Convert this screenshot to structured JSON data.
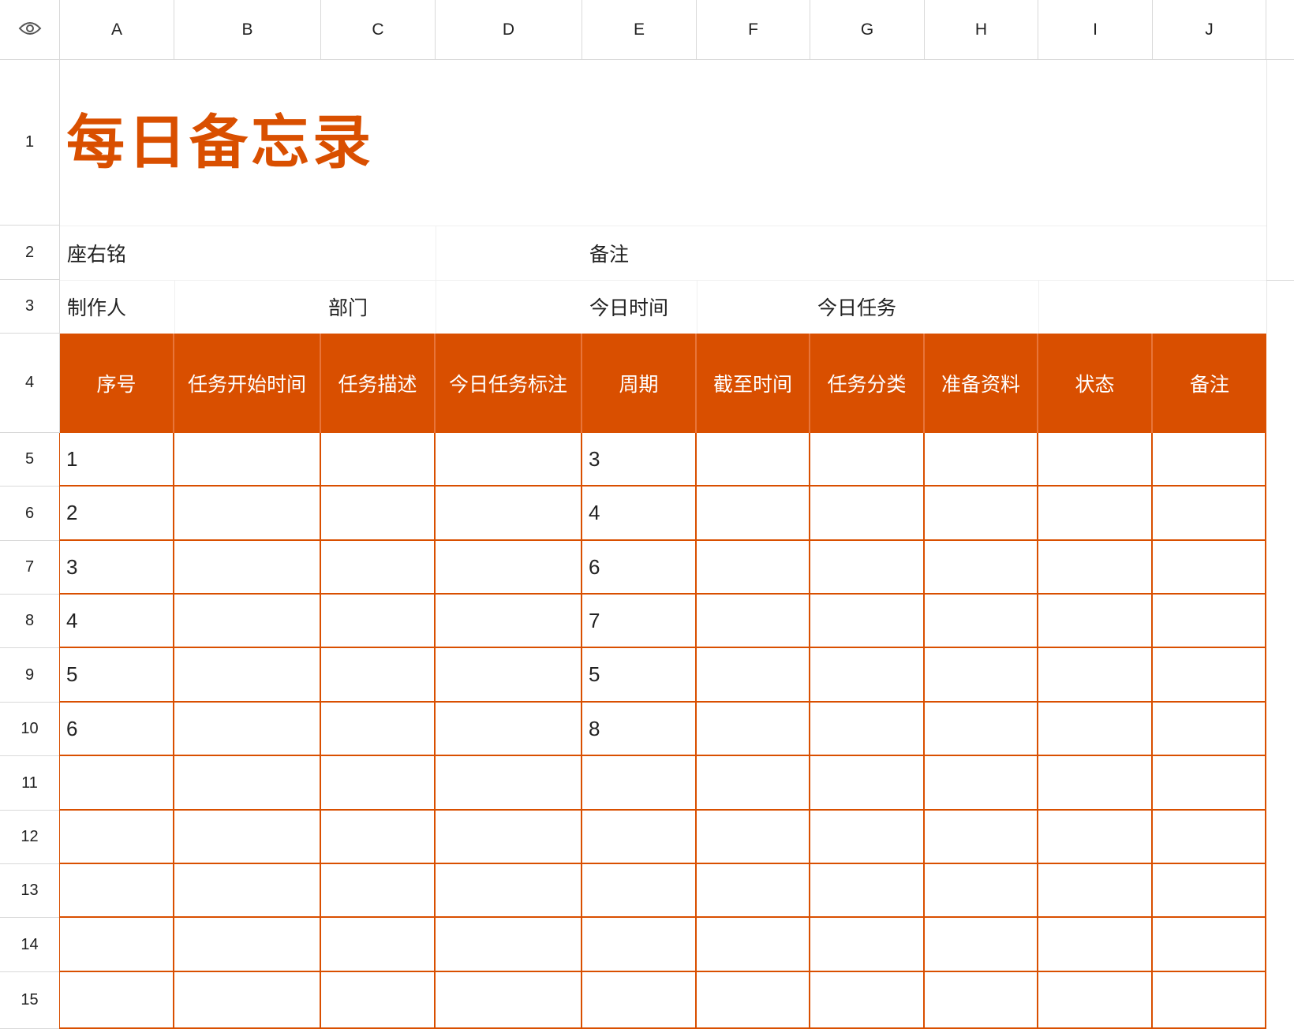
{
  "sheet": {
    "columns": [
      "A",
      "B",
      "C",
      "D",
      "E",
      "F",
      "G",
      "H",
      "I",
      "J"
    ],
    "rows": [
      "1",
      "2",
      "3",
      "4",
      "5",
      "6",
      "7",
      "8",
      "9",
      "10",
      "11",
      "12",
      "13",
      "14",
      "15"
    ],
    "corner_icon": "eye-icon",
    "accent_color": "#d94f00"
  },
  "title": "每日备忘录",
  "info": {
    "motto_label": "座右铭",
    "remark_label": "备注",
    "maker_label": "制作人",
    "dept_label": "部门",
    "today_time_label": "今日时间",
    "today_task_label": "今日任务"
  },
  "table": {
    "headers": [
      "序号",
      "任务开始时间",
      "任务描述",
      "今日任务标注",
      "周期",
      "截至时间",
      "任务分类",
      "准备资料",
      "状态",
      "备注"
    ],
    "seq": [
      "1",
      "2",
      "3",
      "4",
      "5",
      "6",
      "",
      "",
      "",
      "",
      ""
    ],
    "cycle": [
      "3",
      "4",
      "6",
      "7",
      "5",
      "8",
      "",
      "",
      "",
      "",
      ""
    ]
  }
}
